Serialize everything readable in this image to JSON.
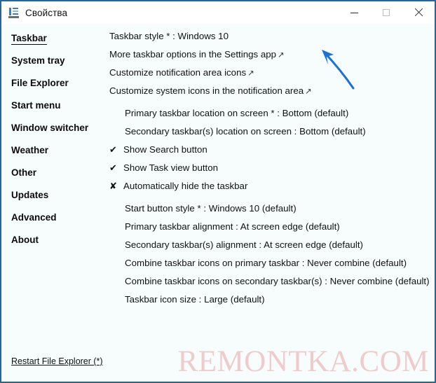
{
  "window": {
    "title": "Свойства",
    "icon": "properties-icon",
    "border_color": "#2a6496",
    "background_color": "#f7fcfd",
    "controls": {
      "minimize": "minimize-icon",
      "maximize": "maximize-icon",
      "close": "close-icon"
    }
  },
  "sidebar": {
    "items": [
      {
        "label": "Taskbar",
        "active": true
      },
      {
        "label": "System tray",
        "active": false
      },
      {
        "label": "File Explorer",
        "active": false
      },
      {
        "label": "Start menu",
        "active": false
      },
      {
        "label": "Window switcher",
        "active": false
      },
      {
        "label": "Weather",
        "active": false
      },
      {
        "label": "Other",
        "active": false
      },
      {
        "label": "Updates",
        "active": false
      },
      {
        "label": "Advanced",
        "active": false
      },
      {
        "label": "About",
        "active": false
      }
    ],
    "restart_link": "Restart File Explorer (*)"
  },
  "main": {
    "options": [
      {
        "text": "Taskbar style * : Windows 10",
        "style": "plain"
      },
      {
        "text": "More taskbar options in the Settings app",
        "style": "link",
        "ext": "↗"
      },
      {
        "text": "Customize notification area icons",
        "style": "link",
        "ext": "↗"
      },
      {
        "text": "Customize system icons in the notification area",
        "style": "link",
        "ext": "↗"
      },
      {
        "text": "Primary taskbar location on screen * : Bottom (default)",
        "style": "indent"
      },
      {
        "text": "Secondary taskbar(s) location on screen : Bottom (default)",
        "style": "indent"
      },
      {
        "text": "Show Search button",
        "style": "mark",
        "glyph": "✔"
      },
      {
        "text": "Show Task view button",
        "style": "mark",
        "glyph": "✔"
      },
      {
        "text": "Automatically hide the taskbar",
        "style": "mark",
        "glyph": "✘"
      },
      {
        "text": "Start button style * : Windows 10 (default)",
        "style": "indent"
      },
      {
        "text": "Primary taskbar alignment : At screen edge (default)",
        "style": "indent"
      },
      {
        "text": "Secondary taskbar(s) alignment : At screen edge (default)",
        "style": "indent"
      },
      {
        "text": "Combine taskbar icons on primary taskbar : Never combine (default)",
        "style": "indent"
      },
      {
        "text": "Combine taskbar icons on secondary taskbar(s) : Never combine (default)",
        "style": "indent"
      },
      {
        "text": "Taskbar icon size : Large (default)",
        "style": "indent"
      }
    ]
  },
  "annotation": {
    "type": "arrow",
    "color": "#1a6fd8",
    "points_to": "Taskbar style * : Windows 10"
  },
  "watermark": {
    "text": "REMONTKA.COM",
    "color": "#f0c9c9"
  }
}
